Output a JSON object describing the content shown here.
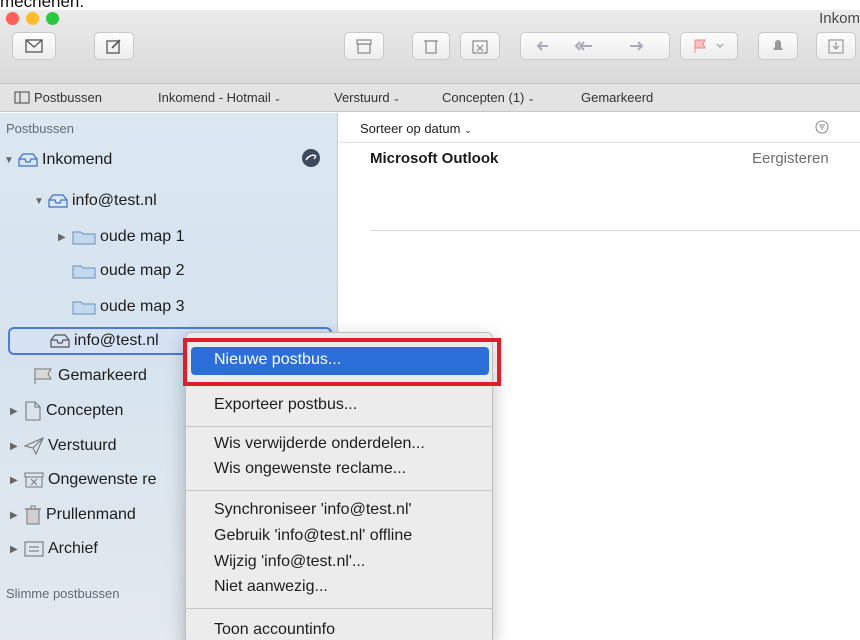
{
  "caption": "mechehen.",
  "window": {
    "title": "Inkom",
    "buttons": [
      "new-message-icon",
      "compose-icon",
      "archive-icon",
      "delete-icon",
      "junk-icon",
      "reply-icon",
      "reply-all-icon",
      "forward-icon",
      "flag-icon",
      "notify-icon",
      "download-icon"
    ]
  },
  "favorites": {
    "mailboxes": "Postbussen",
    "inbox": "Inkomend - Hotmail",
    "sent": "Verstuurd",
    "drafts": "Concepten (1)",
    "flagged": "Gemarkeerd"
  },
  "sidebar": {
    "header": "Postbussen",
    "smart_header": "Slimme postbussen",
    "items": [
      {
        "label": "Inkomend"
      },
      {
        "label": "info@test.nl"
      },
      {
        "label": "oude map 1"
      },
      {
        "label": "oude map 2"
      },
      {
        "label": "oude map 3"
      },
      {
        "label": "info@test.nl"
      },
      {
        "label": "Gemarkeerd"
      },
      {
        "label": "Concepten"
      },
      {
        "label": "Verstuurd"
      },
      {
        "label": "Ongewenste re"
      },
      {
        "label": "Prullenmand"
      },
      {
        "label": "Archief"
      }
    ]
  },
  "message_list": {
    "sort_label": "Sorteer op datum",
    "messages": [
      {
        "sender": "Microsoft Outlook",
        "date": "Eergisteren"
      }
    ]
  },
  "context_menu": {
    "items": [
      "Nieuwe postbus...",
      "Exporteer postbus...",
      "Wis verwijderde onderdelen...",
      "Wis ongewenste reclame...",
      "Synchroniseer 'info@test.nl'",
      "Gebruik 'info@test.nl' offline",
      "Wijzig 'info@test.nl'...",
      "Niet aanwezig...",
      "Toon accountinfo"
    ],
    "highlighted": "Nieuwe postbus...",
    "highlight_color": "#2d6fd8",
    "annotation_color": "#e21d2b"
  }
}
